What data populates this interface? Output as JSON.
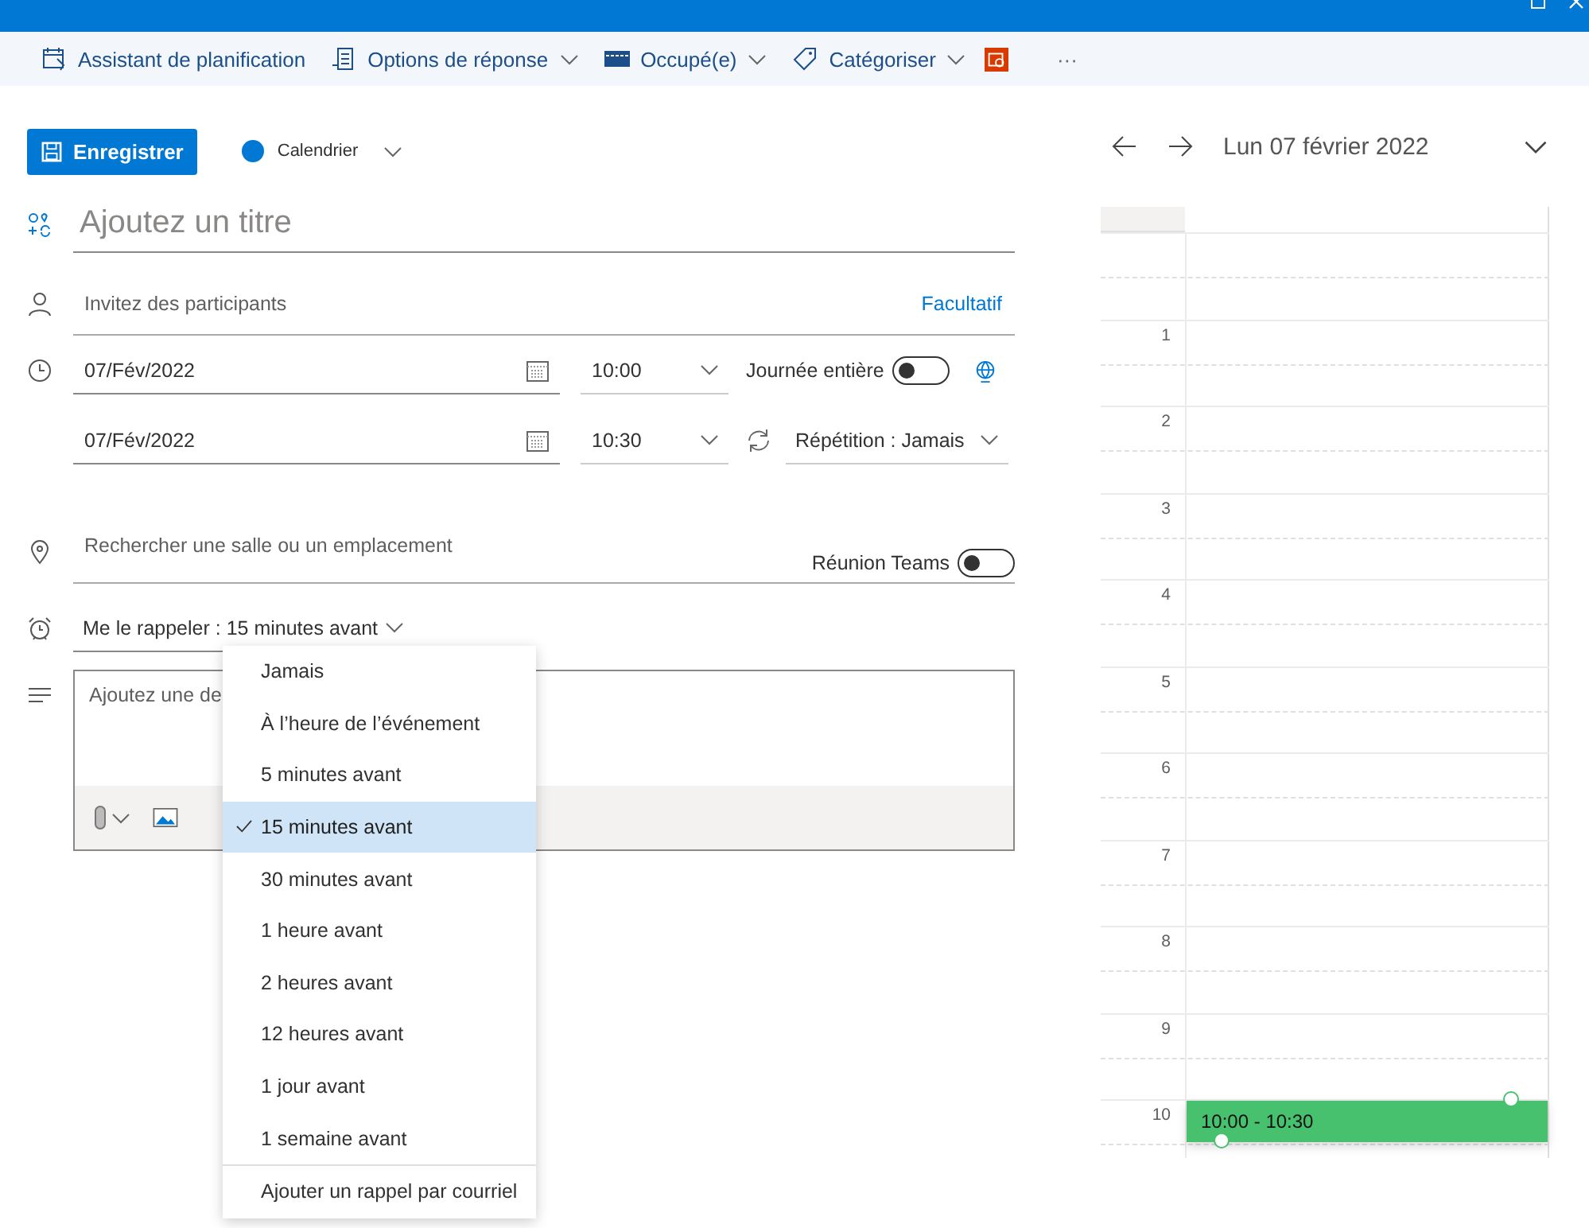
{
  "toolbar": [
    {
      "kind": "scheduling",
      "label": "Assistant de planification",
      "caret": false
    },
    {
      "kind": "response",
      "label": "Options de réponse",
      "caret": true
    },
    {
      "kind": "busy",
      "label": "Occupé(e)",
      "caret": true
    },
    {
      "kind": "tag",
      "label": "Catégoriser",
      "caret": true
    },
    {
      "kind": "addin"
    },
    {
      "kind": "more",
      "label": "···"
    }
  ],
  "save_button": "Enregistrer",
  "calendar_picker": "Calendrier",
  "title_field": {
    "placeholder": "Ajoutez un titre"
  },
  "attendees": {
    "placeholder": "Invitez des participants",
    "optional_link": "Facultatif"
  },
  "start": {
    "date": "07/Fév/2022",
    "time": "10:00"
  },
  "all_day": {
    "label": "Journée entière",
    "on": false
  },
  "end": {
    "date": "07/Fév/2022",
    "time": "10:30"
  },
  "repeat": "Répétition : Jamais",
  "location": {
    "placeholder": "Rechercher une salle ou un emplacement"
  },
  "teams_meeting": {
    "label": "Réunion Teams",
    "on": false
  },
  "reminder": "Me le rappeler : 15 minutes avant",
  "description": {
    "placeholder": "Ajoutez une de"
  },
  "reminder_menu": {
    "items": [
      {
        "label": "Jamais",
        "selected": false
      },
      {
        "label": "À l’heure de l’événement",
        "selected": false
      },
      {
        "label": "5 minutes avant",
        "selected": false
      },
      {
        "label": "15 minutes avant",
        "selected": true
      },
      {
        "label": "30 minutes avant",
        "selected": false
      },
      {
        "label": "1 heure avant",
        "selected": false
      },
      {
        "label": "2 heures avant",
        "selected": false
      },
      {
        "label": "12 heures avant",
        "selected": false
      },
      {
        "label": "1 jour avant",
        "selected": false
      },
      {
        "label": "1 semaine avant",
        "selected": false
      }
    ],
    "footer": "Ajouter un rappel par courriel"
  },
  "day_view": {
    "date": "Lun 07 février 2022",
    "hours": [
      {
        "label": "1"
      },
      {
        "label": "2"
      },
      {
        "label": "3"
      },
      {
        "label": "4"
      },
      {
        "label": "5"
      },
      {
        "label": "6"
      },
      {
        "label": "7"
      },
      {
        "label": "8"
      },
      {
        "label": "9"
      },
      {
        "label": "10",
        "event": "10:00 - 10:30"
      }
    ]
  }
}
